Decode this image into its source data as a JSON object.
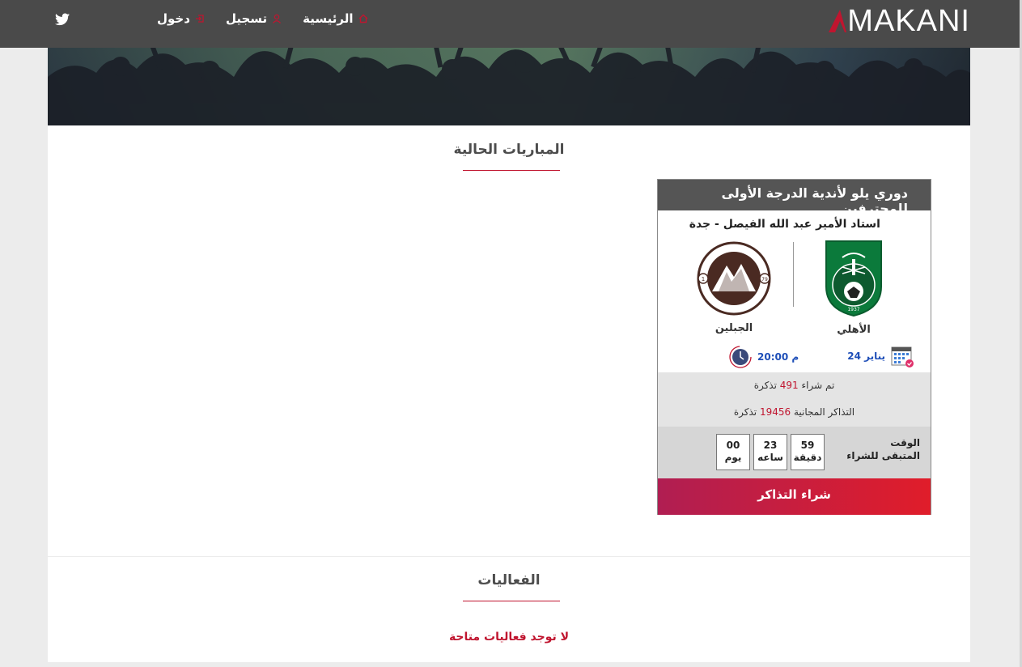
{
  "header": {
    "logo_text": "MAKANI",
    "nav": [
      {
        "label": "الرئيسية",
        "icon": "home-icon"
      },
      {
        "label": "تسجيل",
        "icon": "user-icon"
      },
      {
        "label": "دخول",
        "icon": "login-icon"
      }
    ],
    "social_icon": "twitter-icon"
  },
  "current_matches": {
    "title": "المباريات الحالية"
  },
  "match": {
    "league": "دوري يلو لأندية الدرجة الأولى للمحترفين",
    "stadium": "استاد الأمير عبد الله الفيصل - جدة",
    "home_team": "الأهلي",
    "away_team": "الجبلين",
    "date": "24 يناير",
    "time": "20:00 م",
    "sold_prefix": "تم شراء",
    "sold_count": "491",
    "sold_suffix": "تذكرة",
    "free_prefix": "التذاكر المجانية",
    "free_count": "19456",
    "free_suffix": "تذكرة",
    "remaining_label_1": "الوقت",
    "remaining_label_2": "المتبقى للشراء",
    "countdown": [
      {
        "value": "59",
        "unit": "دقيقة"
      },
      {
        "value": "23",
        "unit": "ساعه"
      },
      {
        "value": "00",
        "unit": "يوم"
      }
    ],
    "buy_label": "شراء التذاكر"
  },
  "events": {
    "title": "الفعاليات",
    "empty_message": "لا توجد فعاليات متاحة"
  },
  "colors": {
    "accent": "#c0152f",
    "header_bg": "#4a4a4a",
    "link_blue": "#1f4fb8"
  }
}
